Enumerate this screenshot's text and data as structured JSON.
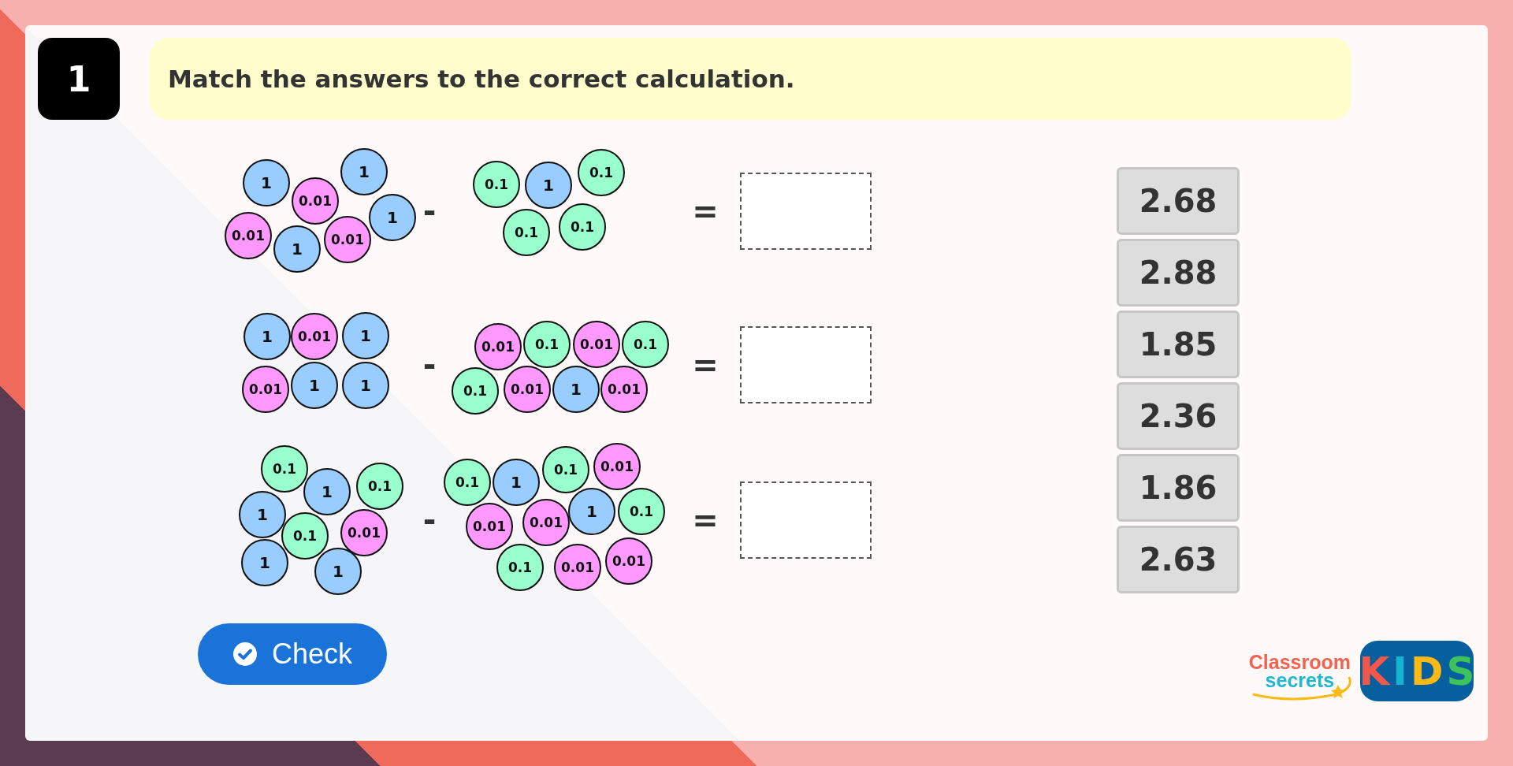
{
  "question": {
    "number": "1",
    "text": "Match the answers to the correct calculation."
  },
  "calculations": [
    {
      "minuend": [
        {
          "label": "1",
          "kind": "ones"
        },
        {
          "label": "0.01",
          "kind": "hundredths"
        },
        {
          "label": "1",
          "kind": "ones"
        },
        {
          "label": "0.01",
          "kind": "hundredths"
        },
        {
          "label": "1",
          "kind": "ones"
        },
        {
          "label": "0.01",
          "kind": "hundredths"
        },
        {
          "label": "1",
          "kind": "ones"
        }
      ],
      "operator": "-",
      "subtrahend": [
        {
          "label": "0.1",
          "kind": "tenths"
        },
        {
          "label": "1",
          "kind": "ones"
        },
        {
          "label": "0.1",
          "kind": "tenths"
        },
        {
          "label": "0.1",
          "kind": "tenths"
        },
        {
          "label": "0.1",
          "kind": "tenths"
        }
      ],
      "equals": "="
    },
    {
      "minuend": [
        {
          "label": "1",
          "kind": "ones"
        },
        {
          "label": "0.01",
          "kind": "hundredths"
        },
        {
          "label": "1",
          "kind": "ones"
        },
        {
          "label": "0.01",
          "kind": "hundredths"
        },
        {
          "label": "1",
          "kind": "ones"
        },
        {
          "label": "1",
          "kind": "ones"
        }
      ],
      "operator": "-",
      "subtrahend": [
        {
          "label": "0.01",
          "kind": "hundredths"
        },
        {
          "label": "0.1",
          "kind": "tenths"
        },
        {
          "label": "0.01",
          "kind": "hundredths"
        },
        {
          "label": "0.1",
          "kind": "tenths"
        },
        {
          "label": "0.1",
          "kind": "tenths"
        },
        {
          "label": "0.01",
          "kind": "hundredths"
        },
        {
          "label": "1",
          "kind": "ones"
        },
        {
          "label": "0.01",
          "kind": "hundredths"
        }
      ],
      "equals": "="
    },
    {
      "minuend": [
        {
          "label": "0.1",
          "kind": "tenths"
        },
        {
          "label": "1",
          "kind": "ones"
        },
        {
          "label": "0.1",
          "kind": "tenths"
        },
        {
          "label": "1",
          "kind": "ones"
        },
        {
          "label": "0.1",
          "kind": "tenths"
        },
        {
          "label": "0.01",
          "kind": "hundredths"
        },
        {
          "label": "1",
          "kind": "ones"
        },
        {
          "label": "1",
          "kind": "ones"
        }
      ],
      "operator": "-",
      "subtrahend": [
        {
          "label": "0.1",
          "kind": "tenths"
        },
        {
          "label": "1",
          "kind": "ones"
        },
        {
          "label": "0.1",
          "kind": "tenths"
        },
        {
          "label": "0.01",
          "kind": "hundredths"
        },
        {
          "label": "0.01",
          "kind": "hundredths"
        },
        {
          "label": "0.01",
          "kind": "hundredths"
        },
        {
          "label": "1",
          "kind": "ones"
        },
        {
          "label": "0.1",
          "kind": "tenths"
        },
        {
          "label": "0.1",
          "kind": "tenths"
        },
        {
          "label": "0.01",
          "kind": "hundredths"
        },
        {
          "label": "0.01",
          "kind": "hundredths"
        }
      ],
      "equals": "="
    }
  ],
  "answers": [
    "2.68",
    "2.88",
    "1.85",
    "2.36",
    "1.86",
    "2.63"
  ],
  "check_button": {
    "label": "Check"
  },
  "logo": {
    "line_1": "Classroom",
    "line_2": "secrets",
    "badge_letters": [
      "K",
      "I",
      "D",
      "S"
    ]
  }
}
